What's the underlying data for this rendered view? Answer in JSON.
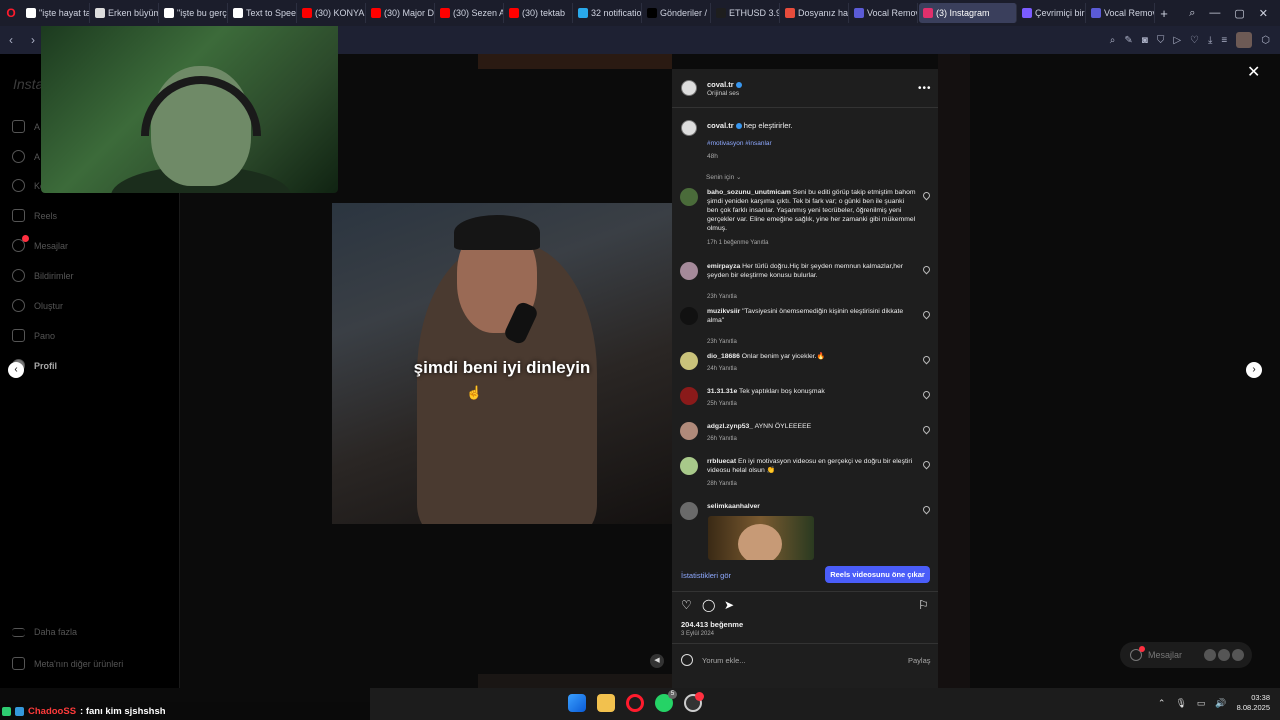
{
  "browser": {
    "tabs": [
      {
        "label": "\"işte hayat ta",
        "icon_color": "#ffffff",
        "active": false
      },
      {
        "label": "Erken büyüm",
        "icon_color": "#dddddd",
        "active": false
      },
      {
        "label": "\"işte bu gerç",
        "icon_color": "#ffffff",
        "active": false
      },
      {
        "label": "Text to Speec",
        "icon_color": "#ffffff",
        "active": false
      },
      {
        "label": "(30) KONYAL",
        "icon_color": "#ff0000",
        "active": false
      },
      {
        "label": "(30) Major D",
        "icon_color": "#ff0000",
        "active": false
      },
      {
        "label": "(30) Sezen A",
        "icon_color": "#ff0000",
        "active": false
      },
      {
        "label": "(30) tektab",
        "icon_color": "#ff0000",
        "active": false
      },
      {
        "label": "32 notificatio",
        "icon_color": "#29a9eb",
        "active": false
      },
      {
        "label": "Gönderiler / ",
        "icon_color": "#000000",
        "active": false
      },
      {
        "label": "ETHUSD 3.92",
        "icon_color": "#1e1e1e",
        "active": false
      },
      {
        "label": "Dosyanız haz",
        "icon_color": "#e74c3c",
        "active": false
      },
      {
        "label": "Vocal Remov",
        "icon_color": "#5b5bd6",
        "active": false
      },
      {
        "label": "(3) Instagram",
        "icon_color": "#e1306c",
        "active": true
      },
      {
        "label": "Çevrimiçi bir",
        "icon_color": "#7b5cff",
        "active": false
      },
      {
        "label": "Vocal Remov",
        "icon_color": "#5b5bd6",
        "active": false
      }
    ]
  },
  "sidebar": {
    "logo": "Insta",
    "items": [
      {
        "label": "A",
        "top": 0
      },
      {
        "label": "A",
        "top": 0
      },
      {
        "label": "Ke",
        "top": 0
      },
      {
        "label": "Reels",
        "top": 0
      },
      {
        "label": "Mesajlar",
        "top": 0
      },
      {
        "label": "Bildirimler",
        "top": 0
      },
      {
        "label": "Oluştur",
        "top": 0
      },
      {
        "label": "Pano",
        "top": 0
      },
      {
        "label": "Profil",
        "top": 0
      }
    ],
    "more": "Daha fazla",
    "meta": "Meta'nın diğer ürünleri",
    "messages_badge": "1"
  },
  "video": {
    "caption": "şimdi beni iyi dinleyin"
  },
  "post": {
    "username": "coval.tr",
    "audio": "Orijinal ses",
    "caption_user": "coval.tr",
    "caption_text": "hep eleştirirler.",
    "hashtags": "#motivasyon #insanlar",
    "caption_age": "48h",
    "sort_label": "Senin için",
    "comments": [
      {
        "user": "baho_sozunu_unutmicam",
        "text": "Seni bu editi görüp takip etmiştim bahom şimdi yeniden karşıma çıktı. Tek bi fark var; o günki ben ile şuanki ben çok farklı insanlar. Yaşanmış yeni tecrübeler, öğrenilmiş yeni gerçekler var. Eline emeğine sağlık, yine her zamanki gibi mükemmel olmuş.",
        "meta": "17h   1 beğenme   Yanıtla",
        "avatar": "#4a6b3a"
      },
      {
        "user": "emirpayza",
        "text": "Her türlü doğru.Hiç bir şeyden memnun kalmazlar,her şeyden bir eleştirme konusu bulurlar.",
        "meta": "23h   Yanıtla",
        "avatar": "#a58a9a"
      },
      {
        "user": "muzikvsiir",
        "text": "\"Tavsiyesini önemsemediğin kişinin eleştirisini dikkate alma\"",
        "meta": "23h   Yanıtla",
        "avatar": "#111111"
      },
      {
        "user": "dio_18686",
        "text": "Onlar benim yar yicekler.🔥",
        "meta": "24h   Yanıtla",
        "avatar": "#c9c27a"
      },
      {
        "user": "31.31.31e",
        "text": "Tek yaptıkları boş konuşmak",
        "meta": "25h   Yanıtla",
        "avatar": "#8a1a1a"
      },
      {
        "user": "adgzl.zynp53_",
        "text": "AYNN ÖYLEEEEE",
        "meta": "26h   Yanıtla",
        "avatar": "#b08a7a"
      },
      {
        "user": "rrbluecat",
        "text": "En iyi motivasyon videosu en gerçekçi ve doğru bir eleştiri videosu helal olsun 👏",
        "meta": "28h   Yanıtla",
        "avatar": "#a8c98a"
      },
      {
        "user": "selimkaanhalver",
        "text": "",
        "meta": "",
        "avatar": "#6a6a6a"
      }
    ],
    "stats_link": "İstatistikleri gör",
    "promote_button": "Reels videosunu öne çıkar",
    "likes": "204.413 beğenme",
    "date": "3 Eylül 2024",
    "comment_placeholder": "Yorum ekle...",
    "share": "Paylaş"
  },
  "messages_pill": {
    "label": "Mesajlar"
  },
  "chat": {
    "username": "ChadooSS",
    "message": ": fanı kim sjshshsh"
  },
  "taskbar": {
    "whatsapp_badge": "5",
    "time": "03:38",
    "date": "8.08.2025"
  },
  "colors": {
    "accent": "#4a5df9",
    "link": "#8ea9ff",
    "opera": "#ff1b2d"
  }
}
